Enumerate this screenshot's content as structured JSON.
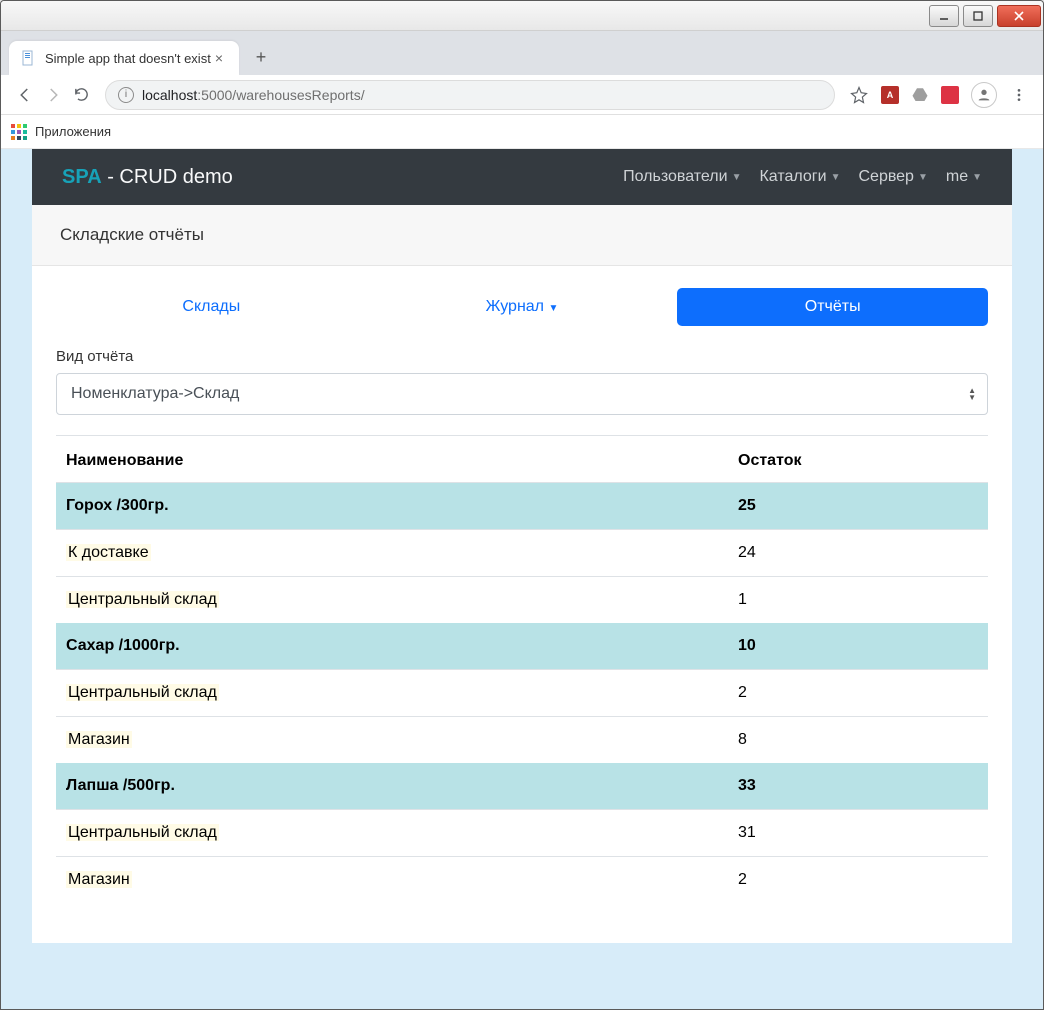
{
  "browser": {
    "tab_title": "Simple app that doesn't exist",
    "url_host": "localhost",
    "url_port_path": ":5000/warehousesReports/",
    "bookmarks_apps": "Приложения"
  },
  "navbar": {
    "brand_spa": "SPA",
    "brand_rest": " - CRUD demo",
    "menu": {
      "users": "Пользователи",
      "catalogs": "Каталоги",
      "server": "Сервер",
      "me": "me"
    }
  },
  "card": {
    "header": "Складские отчёты",
    "tabs": {
      "warehouses": "Склады",
      "journal": "Журнал",
      "reports": "Отчёты"
    },
    "form": {
      "report_type_label": "Вид отчёта",
      "report_type_value": "Номенклатура->Склад"
    },
    "table": {
      "col_name": "Наименование",
      "col_qty": "Остаток",
      "groups": [
        {
          "name": "Горох /300гр.",
          "total": "25",
          "rows": [
            {
              "name": "К доставке",
              "qty": "24"
            },
            {
              "name": "Центральный склад",
              "qty": "1"
            }
          ]
        },
        {
          "name": "Сахар /1000гр.",
          "total": "10",
          "rows": [
            {
              "name": "Центральный склад",
              "qty": "2"
            },
            {
              "name": "Магазин",
              "qty": "8"
            }
          ]
        },
        {
          "name": "Лапша /500гр.",
          "total": "33",
          "rows": [
            {
              "name": "Центральный склад",
              "qty": "31"
            },
            {
              "name": "Магазин",
              "qty": "2"
            }
          ]
        }
      ]
    }
  }
}
